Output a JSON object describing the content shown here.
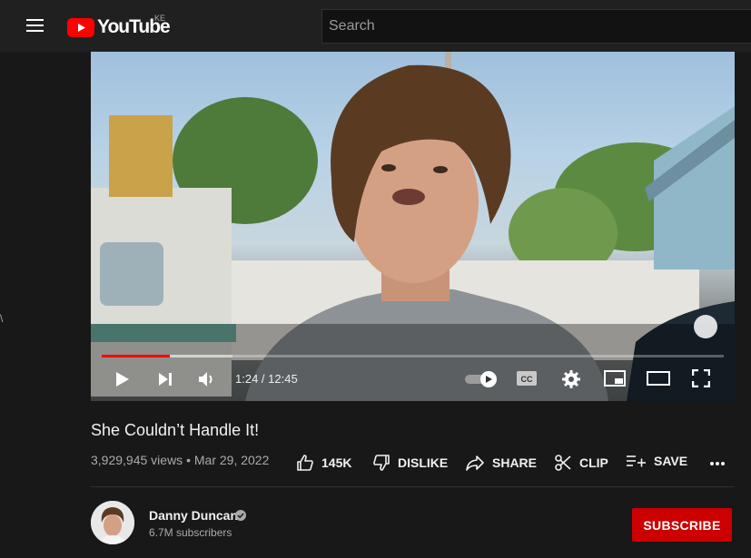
{
  "header": {
    "logo_text": "YouTube",
    "country_code": "KE",
    "search_placeholder": "Search"
  },
  "player": {
    "current_time": "1:24",
    "duration": "12:45",
    "time_display": "1:24 / 12:45",
    "progress_fraction": 0.11,
    "buffered_fraction": 0.21,
    "progress_color": "#ff0000",
    "controls": [
      "play-icon",
      "next-icon",
      "volume-icon",
      "autoplay-toggle",
      "captions-icon",
      "settings-icon",
      "miniplayer-icon",
      "theater-icon",
      "fullscreen-icon"
    ],
    "captions_label": "CC"
  },
  "video": {
    "title": "She Couldn’t Handle It!",
    "views": "3,929,945 views",
    "date": "Mar 29, 2022",
    "meta_separator": "•"
  },
  "actions": {
    "like_count": "145K",
    "dislike_label": "DISLIKE",
    "share_label": "SHARE",
    "clip_label": "CLIP",
    "save_label": "SAVE"
  },
  "channel": {
    "name": "Danny Duncan",
    "subscribers": "6.7M subscribers",
    "subscribe_label": "SUBSCRIBE",
    "verified": true
  },
  "colors": {
    "background": "#181818",
    "topbar": "#202020",
    "brand_red": "#ff0000",
    "subscribe_red": "#cc0000",
    "secondary_text": "#aaaaaa"
  }
}
